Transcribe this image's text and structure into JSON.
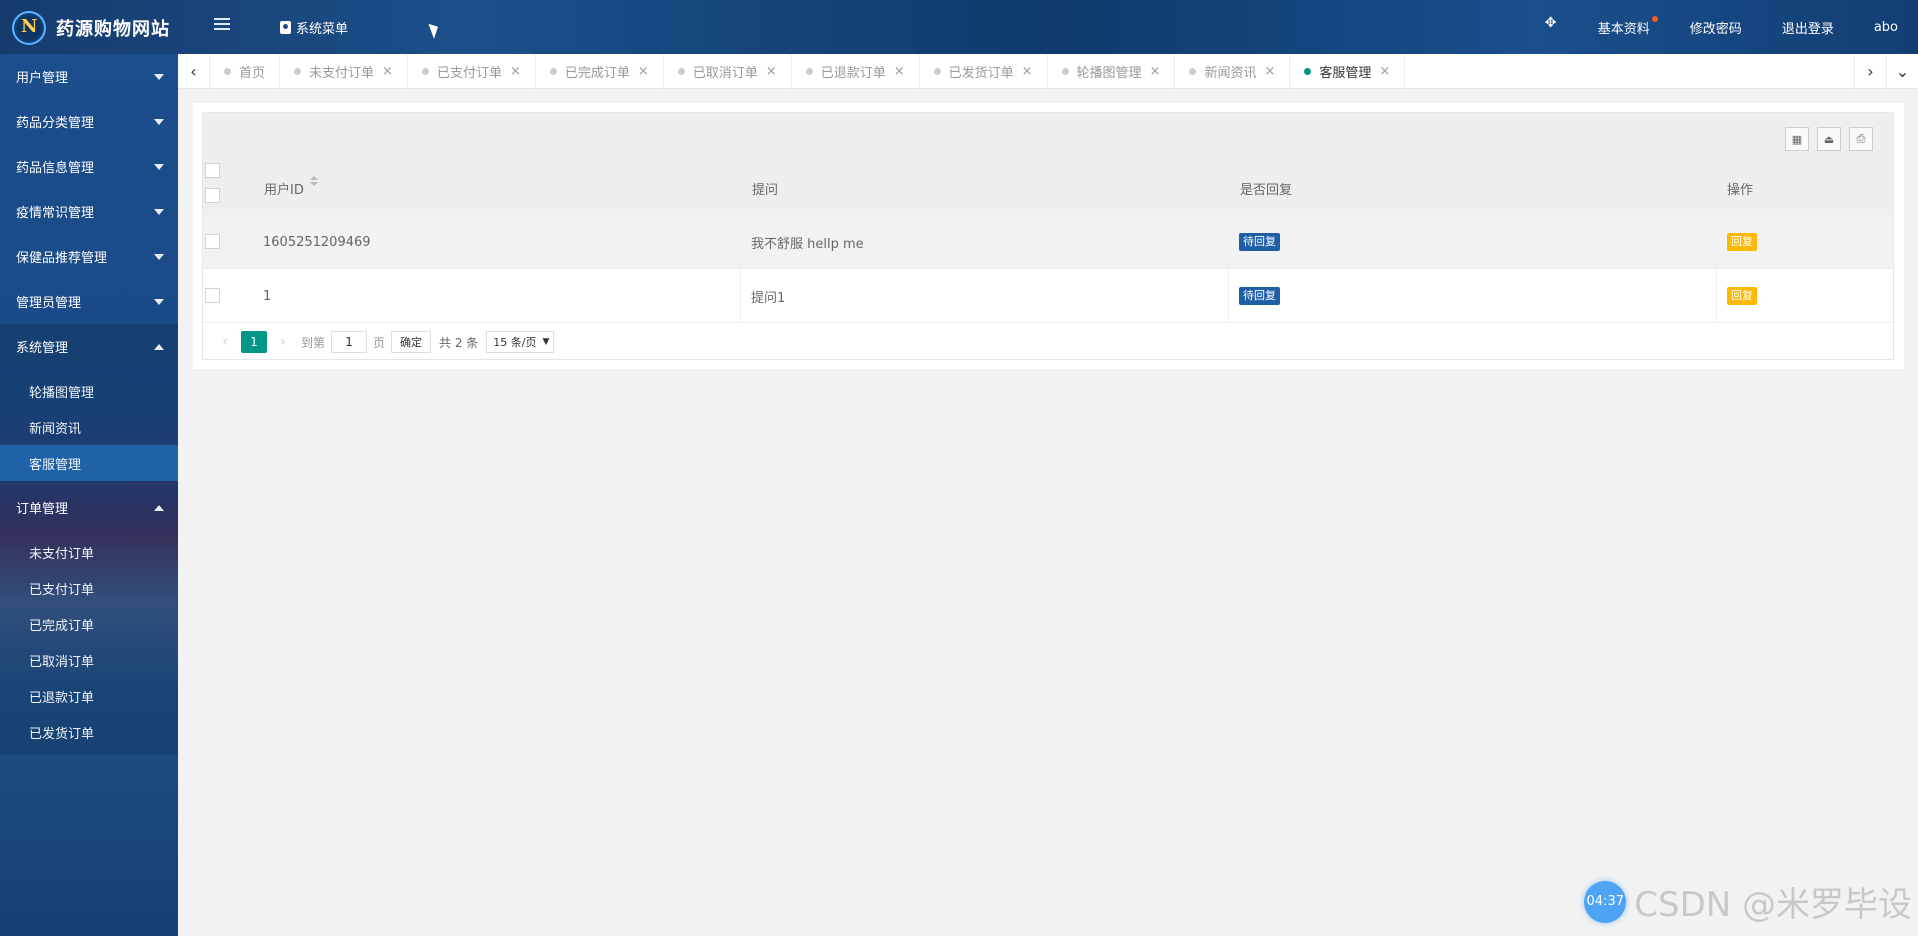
{
  "header": {
    "site_title": "药源购物网站",
    "sys_menu": "系统菜单",
    "basic_info": "基本资料",
    "change_password": "修改密码",
    "logout": "退出登录",
    "username": "abo"
  },
  "sidebar": {
    "groups": [
      {
        "label": "用户管理"
      },
      {
        "label": "药品分类管理"
      },
      {
        "label": "药品信息管理"
      },
      {
        "label": "疫情常识管理"
      },
      {
        "label": "保健品推荐管理"
      },
      {
        "label": "管理员管理"
      },
      {
        "label": "系统管理",
        "sub": [
          "轮播图管理",
          "新闻资讯",
          "客服管理"
        ]
      },
      {
        "label": "订单管理",
        "sub": [
          "未支付订单",
          "已支付订单",
          "已完成订单",
          "已取消订单",
          "已退款订单",
          "已发货订单"
        ]
      }
    ]
  },
  "tabs": [
    "首页",
    "未支付订单",
    "已支付订单",
    "已完成订单",
    "已取消订单",
    "已退款订单",
    "已发货订单",
    "轮播图管理",
    "新闻资讯",
    "客服管理"
  ],
  "table": {
    "headers": [
      "用户ID",
      "提问",
      "是否回复",
      "操作"
    ],
    "rows": [
      {
        "user_id": "1605251209469",
        "question": "我不舒服 hellp me",
        "status": "待回复",
        "action": "回复"
      },
      {
        "user_id": "1",
        "question": "提问1",
        "status": "待回复",
        "action": "回复"
      }
    ]
  },
  "pager": {
    "current": "1",
    "goto_label": "到第",
    "goto_value": "1",
    "unit": "页",
    "confirm": "确定",
    "total": "共 2 条",
    "page_size": "15 条/页"
  },
  "watermark": {
    "timer": "04:37",
    "text": "CSDN @米罗毕设"
  },
  "colors": {
    "accent": "#009688",
    "header": "#1c4f8a",
    "badge_blue": "#1e5fa8",
    "badge_orange": "#ffb800"
  }
}
